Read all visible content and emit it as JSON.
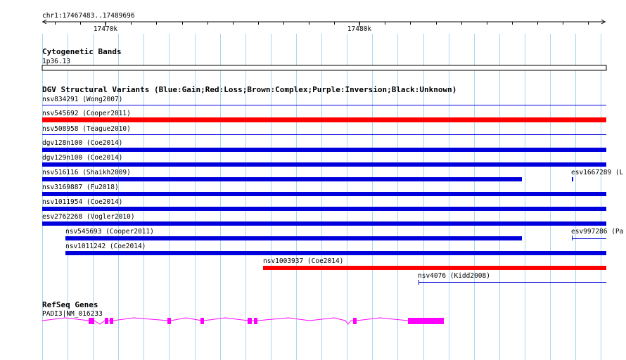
{
  "ruler": {
    "coords": "chr1:17467483..17489696",
    "ticks": [
      "17470k",
      "17480k"
    ]
  },
  "cytoband": {
    "title": "Cytogenetic Bands",
    "band": "1p36.13"
  },
  "dgv": {
    "title": "DGV Structural Variants (Blue:Gain;Red:Loss;Brown:Complex;Purple:Inversion;Black:Unknown)",
    "features": [
      {
        "label": "nsv834291 (Wong2007)",
        "color": "#0000dd",
        "style": "thin"
      },
      {
        "label": "nsv545692 (Cooper2011)",
        "color": "#ff0000",
        "style": "thick"
      },
      {
        "label": "nsv508958 (Teague2010)",
        "color": "#0000dd",
        "style": "thin"
      },
      {
        "label": "dgv128n100 (Coe2014)",
        "color": "#0000dd",
        "style": "thick"
      },
      {
        "label": "dgv129n100 (Coe2014)",
        "color": "#0000dd",
        "style": "thick"
      },
      {
        "label": "nsv516116 (Shaikh2009)",
        "color": "#0000dd",
        "style": "thick"
      },
      {
        "label": "esv1667289 (L",
        "color": "#0000dd",
        "style": "tick"
      },
      {
        "label": "nsv3169887 (Fu2018)",
        "color": "#0000dd",
        "style": "thick"
      },
      {
        "label": "nsv1011954 (Coe2014)",
        "color": "#0000dd",
        "style": "thick"
      },
      {
        "label": "esv2762268 (Vogler2010)",
        "color": "#0000dd",
        "style": "thick"
      },
      {
        "label": "nsv545693 (Cooper2011)",
        "color": "#0000dd",
        "style": "thick"
      },
      {
        "label": "esv997286 (Pa",
        "color": "#0000dd",
        "style": "thin"
      },
      {
        "label": "nsv1011242 (Coe2014)",
        "color": "#0000dd",
        "style": "thick"
      },
      {
        "label": "nsv1003937 (Coe2014)",
        "color": "#ff0000",
        "style": "thick"
      },
      {
        "label": "nsv4076 (Kidd2008)",
        "color": "#0000dd",
        "style": "thin"
      }
    ]
  },
  "refseq": {
    "title": "RefSeq Genes",
    "gene_label": "PADI3|NM_016233",
    "color": "#ff00ff"
  },
  "colors": {
    "grid": "#a8d8ee",
    "gain": "#0000dd",
    "loss": "#ff0000",
    "gene": "#ff00ff"
  }
}
